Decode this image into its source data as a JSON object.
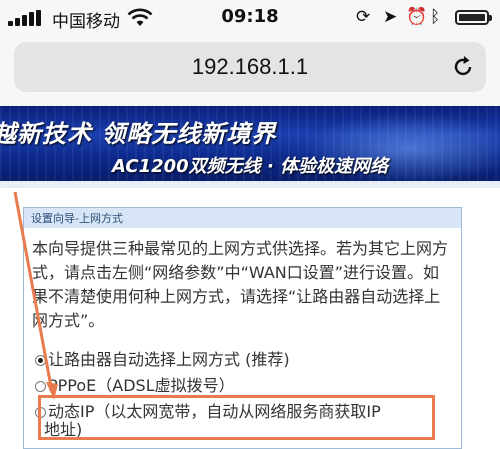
{
  "status_bar": {
    "carrier": "中国移动",
    "time": "09:18",
    "icons": [
      "signal-icon",
      "wifi-icon",
      "rotation-lock-icon",
      "location-icon",
      "alarm-icon",
      "bluetooth-icon",
      "battery-icon"
    ]
  },
  "browser": {
    "url": "192.168.1.1"
  },
  "banner": {
    "slogan": "越新技术 领略无线新境界",
    "subtitle": "AC1200双频无线 · 体验极速网络"
  },
  "wizard": {
    "title": "设置向导-上网方式",
    "description": "本向导提供三种最常见的上网方式供选择。若为其它上网方式，请点击左侧“网络参数”中“WAN口设置”进行设置。如果不清楚使用何种上网方式，请选择“让路由器自动选择上网方式”。",
    "options": [
      {
        "label": "让路由器自动选择上网方式 (推荐)",
        "checked": true
      },
      {
        "label": "PPPoE（ADSL虚拟拨号）",
        "checked": false
      },
      {
        "label": "动态IP（以太网宽带，自动从网络服务商获取IP",
        "label_cont": "地址)",
        "checked": false
      }
    ]
  },
  "colors": {
    "annotation": "#e87a4d",
    "panel_header": "#d7e5f6",
    "banner": "#1a3fb0"
  }
}
